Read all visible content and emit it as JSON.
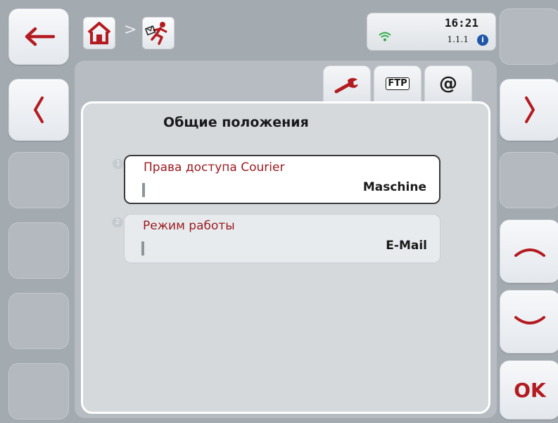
{
  "header": {
    "breadcrumb": [
      "home-icon",
      "emergency-exit-icon"
    ],
    "breadcrumb_separator": ">",
    "status": {
      "time": "16:21",
      "version": "1.1.1",
      "info_badge": "i",
      "wifi_icon": "wifi-icon"
    }
  },
  "tabs": [
    {
      "name": "general-settings",
      "icon": "wrench-icon",
      "selected": true
    },
    {
      "name": "ftp",
      "label": "FTP",
      "selected": false
    },
    {
      "name": "email",
      "label": "@",
      "selected": false
    }
  ],
  "panel": {
    "title": "Общие положения",
    "items": [
      {
        "index": "1",
        "label": "Права доступа Courier",
        "value": "Maschine",
        "selected": true
      },
      {
        "index": "2",
        "label": "Режим работы",
        "value": "E-Mail",
        "selected": false
      }
    ]
  },
  "left_buttons": [
    {
      "icon": "back-arrow-icon",
      "enabled": true
    },
    {
      "icon": "chevron-left-icon",
      "enabled": true
    },
    {
      "enabled": false
    },
    {
      "enabled": false
    },
    {
      "enabled": false
    },
    {
      "enabled": false
    }
  ],
  "right_buttons": [
    {
      "enabled": false
    },
    {
      "icon": "chevron-right-icon",
      "enabled": true
    },
    {
      "enabled": false
    },
    {
      "icon": "chevron-up-icon",
      "enabled": true
    },
    {
      "icon": "chevron-down-icon",
      "enabled": true
    },
    {
      "label": "OK",
      "enabled": true
    }
  ],
  "colors": {
    "accent": "#b31b20",
    "item_label": "#9a1a1f",
    "background": "#a3aab0",
    "panel": "#d5d9dc"
  }
}
